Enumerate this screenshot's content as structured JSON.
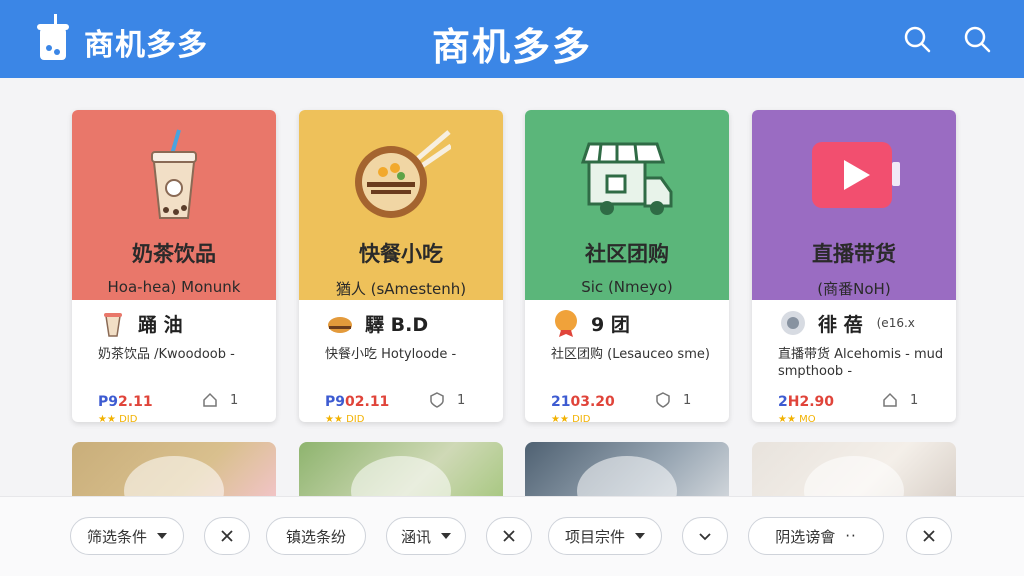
{
  "header": {
    "brand": "商机多多",
    "title": "商机多多"
  },
  "cards": [
    {
      "category": "奶茶饮品",
      "subtitle": "Hoa-hea) Monunk",
      "name": "踊 油",
      "extra": "",
      "desc": "奶茶饮品 /Kwoodoob -",
      "price_a": "P9",
      "price_b": "2.11",
      "count": "1",
      "rating": "★★ DID"
    },
    {
      "category": "快餐小吃",
      "subtitle": "猶人 (sAmestenh)",
      "name": "驛 B.D",
      "extra": "",
      "desc": "快餐小吃 Hotyloode -",
      "price_a": "P9",
      "price_b": "02.11",
      "count": "1",
      "rating": "★★ DID"
    },
    {
      "category": "社区团购",
      "subtitle": "Sic (Nmeyo)",
      "name": "9 团",
      "extra": "",
      "desc": "社区团购 (Lesauceo sme)",
      "price_a": "21",
      "price_b": "03.20",
      "count": "1",
      "rating": "★★ DID"
    },
    {
      "category": "直播带货",
      "subtitle": "(商番NoH)",
      "name": "徘 蓓",
      "extra": "(e16.x",
      "desc": "直播带货 Alcehomis - mud smpthoob -",
      "price_a": "2",
      "price_b": "H2.90",
      "count": "1",
      "rating": "★★ MO"
    }
  ],
  "filters": [
    {
      "label": "筛选条件",
      "type": "dropdown"
    },
    {
      "label": "",
      "type": "close"
    },
    {
      "label": "镇选条纷",
      "type": "plain"
    },
    {
      "label": "涵讯",
      "type": "dropdown"
    },
    {
      "label": "",
      "type": "close"
    },
    {
      "label": "项目宗件",
      "type": "dropdown"
    },
    {
      "label": "",
      "type": "chevron"
    },
    {
      "label": "阴选谤會",
      "type": "more"
    },
    {
      "label": "",
      "type": "close"
    }
  ],
  "colors": {
    "header": "#3b86e6",
    "card1": "#e9776a",
    "card2": "#eec15a",
    "card3": "#5bb67a",
    "card4": "#9a6cc2"
  }
}
